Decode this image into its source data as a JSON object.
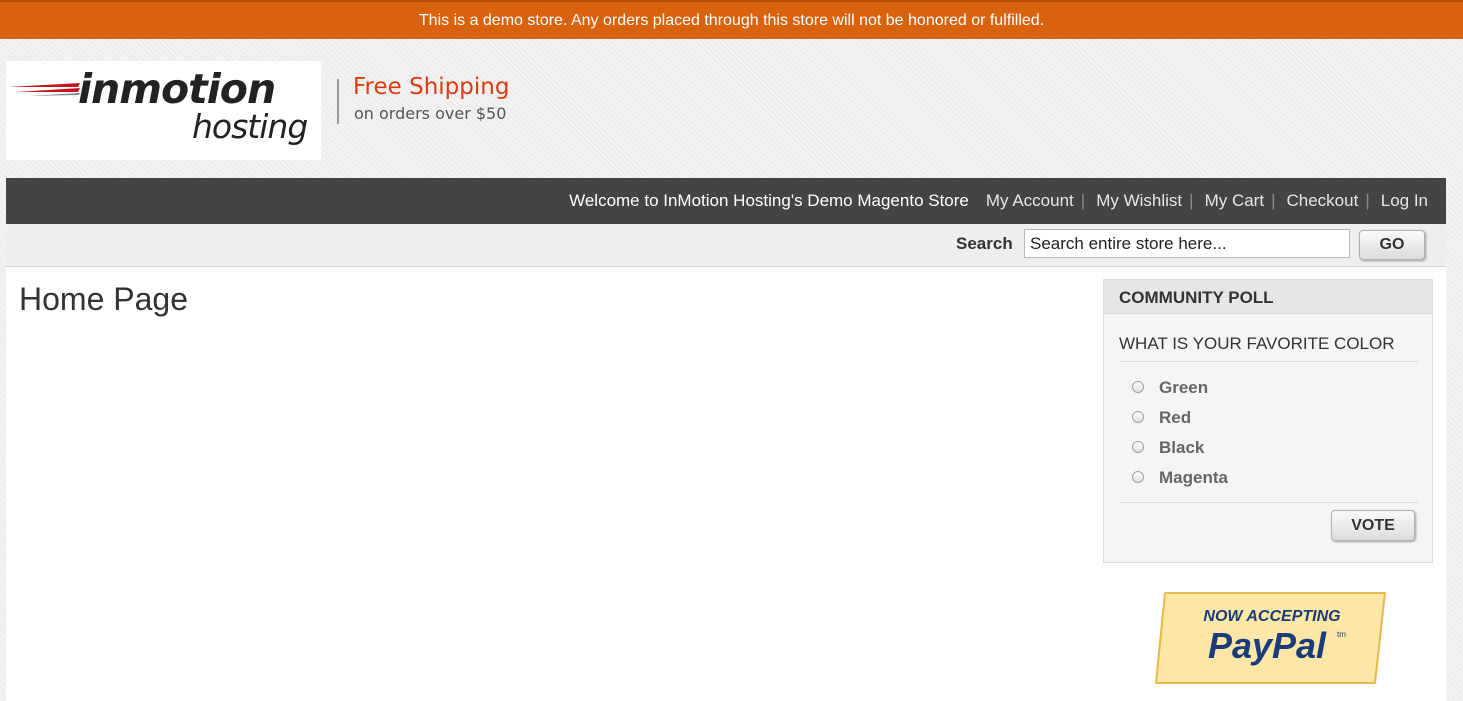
{
  "notice": {
    "text": "This is a demo store. Any orders placed through this store will not be honored or fulfilled."
  },
  "header": {
    "logo_line1": "inmotion",
    "logo_line2": "hosting",
    "promo_title": "Free Shipping",
    "promo_subtitle": "on orders over $50"
  },
  "topbar": {
    "welcome": "Welcome to InMotion Hosting's Demo Magento Store",
    "links": [
      "My Account",
      "My Wishlist",
      "My Cart",
      "Checkout",
      "Log In"
    ],
    "separator": "|"
  },
  "search": {
    "label": "Search",
    "value": "",
    "placeholder": "Search entire store here...",
    "button": "GO"
  },
  "main": {
    "title": "Home Page"
  },
  "poll": {
    "heading": "COMMUNITY POLL",
    "question": "WHAT IS YOUR FAVORITE COLOR",
    "options": [
      "Green",
      "Red",
      "Black",
      "Magenta"
    ],
    "vote_button": "VOTE"
  },
  "paypal": {
    "line1": "NOW ACCEPTING",
    "line2": "PayPal",
    "tm": "tm"
  },
  "colors": {
    "notice_bg": "#d9620f",
    "topbar_bg": "#444444",
    "promo_red": "#e03a10",
    "paypal_blue": "#1b3b7a",
    "paypal_badge": "#fde7a6"
  }
}
